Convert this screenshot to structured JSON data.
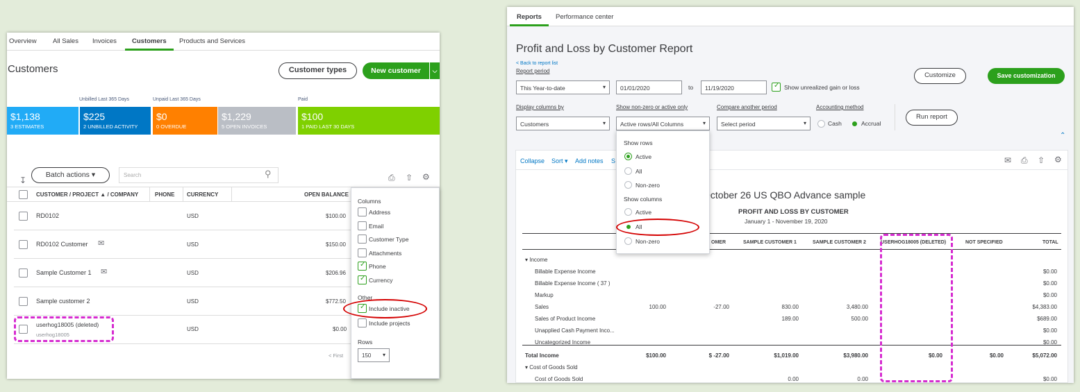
{
  "left": {
    "tabs": [
      "Overview",
      "All Sales",
      "Invoices",
      "Customers",
      "Products and Services"
    ],
    "title": "Customers",
    "customer_types_button": "Customer types",
    "new_customer_button": "New customer",
    "labels": {
      "unbilled": "Unbilled Last 365 Days",
      "unpaid": "Unpaid Last 365 Days",
      "paid": "Paid"
    },
    "tiles": [
      {
        "amount": "$1,138",
        "caption": "3 ESTIMATES",
        "color": "#21abf6"
      },
      {
        "amount": "$225",
        "caption": "2 UNBILLED ACTIVITY",
        "color": "#0077c5"
      },
      {
        "amount": "$0",
        "caption": "0 OVERDUE",
        "color": "#ff8000"
      },
      {
        "amount": "$1,229",
        "caption": "5 OPEN INVOICES",
        "color": "#babec5"
      },
      {
        "amount": "$100",
        "caption": "1 PAID LAST 30 DAYS",
        "color": "#7fd000"
      }
    ],
    "batch_actions": "Batch actions",
    "search_placeholder": "Search",
    "columns": [
      "CUSTOMER / PROJECT ▲ / COMPANY",
      "PHONE",
      "CURRENCY",
      "OPEN BALANCE"
    ],
    "rows": [
      {
        "name": "RD0102",
        "sub": "",
        "currency": "USD",
        "balance": "$100.00"
      },
      {
        "name": "RD0102 Customer",
        "sub": "",
        "currency": "USD",
        "balance": "$150.00"
      },
      {
        "name": "Sample Customer 1",
        "sub": "",
        "currency": "USD",
        "balance": "$206.96"
      },
      {
        "name": "Sample customer 2",
        "sub": "",
        "currency": "USD",
        "balance": "$772.50"
      },
      {
        "name": "userhog18005 (deleted)",
        "sub": "userhog18005",
        "currency": "USD",
        "balance": "$0.00"
      }
    ],
    "pager": "< First",
    "settings": {
      "columns_title": "Columns",
      "columns": [
        {
          "label": "Address",
          "checked": false
        },
        {
          "label": "Email",
          "checked": false
        },
        {
          "label": "Customer Type",
          "checked": false
        },
        {
          "label": "Attachments",
          "checked": false
        },
        {
          "label": "Phone",
          "checked": true
        },
        {
          "label": "Currency",
          "checked": true
        }
      ],
      "other_title": "Other",
      "other": [
        {
          "label": "Include inactive",
          "checked": true
        },
        {
          "label": "Include projects",
          "checked": false
        }
      ],
      "rows_title": "Rows",
      "rows_value": "150"
    }
  },
  "right": {
    "tabs": [
      "Reports",
      "Performance center"
    ],
    "title": "Profit and Loss by Customer Report",
    "back_link": "< Back to report list",
    "report_period_label": "Report period",
    "period_value": "This Year-to-date",
    "date_from": "01/01/2020",
    "to_label": "to",
    "date_to": "11/19/2020",
    "unrealized_label": "Show unrealized gain or loss",
    "customize_button": "Customize",
    "save_button": "Save customization",
    "display_columns_label": "Display columns by",
    "display_columns_value": "Customers",
    "nonzero_label": "Show non-zero or active only",
    "nonzero_value": "Active rows/All Columns",
    "compare_label": "Compare another period",
    "compare_value": "Select period",
    "accounting_label": "Accounting method",
    "cash_label": "Cash",
    "accrual_label": "Accrual",
    "run_report_button": "Run report",
    "dropdown": {
      "rows_title": "Show rows",
      "rows": [
        {
          "label": "Active",
          "on": true
        },
        {
          "label": "All",
          "on": false
        },
        {
          "label": "Non-zero",
          "on": false
        }
      ],
      "cols_title": "Show columns",
      "cols": [
        {
          "label": "Active",
          "on": false
        },
        {
          "label": "All",
          "on": true
        },
        {
          "label": "Non-zero",
          "on": false
        }
      ]
    },
    "toolbar": {
      "collapse": "Collapse",
      "sort": "Sort ▾",
      "add_notes": "Add notes",
      "extra": "S"
    },
    "company": "October 26 US QBO Advance sample",
    "report_heading": "PROFIT AND LOSS BY CUSTOMER",
    "report_dates": "January 1 - November 19, 2020",
    "col_headers": [
      "OMER",
      "SAMPLE CUSTOMER 1",
      "SAMPLE CUSTOMER 2",
      "USERHOG18005 (DELETED)",
      "NOT SPECIFIED",
      "TOTAL"
    ],
    "lines": [
      {
        "label": "▾ Income",
        "indent": 0,
        "bold": false,
        "vals": [
          "",
          "",
          "",
          "",
          "",
          "",
          "",
          ""
        ]
      },
      {
        "label": "Billable Expense Income",
        "indent": 1,
        "bold": false,
        "vals": [
          "",
          "",
          "",
          "",
          "",
          "",
          "",
          "$0.00"
        ]
      },
      {
        "label": "Billable Expense Income ( 37 )",
        "indent": 1,
        "bold": false,
        "vals": [
          "",
          "",
          "",
          "",
          "",
          "",
          "",
          "$0.00"
        ]
      },
      {
        "label": "Markup",
        "indent": 1,
        "bold": false,
        "vals": [
          "",
          "",
          "",
          "",
          "",
          "",
          "",
          "$0.00"
        ]
      },
      {
        "label": "Sales",
        "indent": 1,
        "bold": false,
        "vals": [
          "100.00",
          "-27.00",
          "830.00",
          "3,480.00",
          "",
          "",
          "",
          "$4,383.00"
        ]
      },
      {
        "label": "Sales of Product Income",
        "indent": 1,
        "bold": false,
        "vals": [
          "",
          "",
          "189.00",
          "500.00",
          "",
          "",
          "",
          "$689.00"
        ]
      },
      {
        "label": "Unapplied Cash Payment Inco...",
        "indent": 1,
        "bold": false,
        "vals": [
          "",
          "",
          "",
          "",
          "",
          "",
          "",
          "$0.00"
        ]
      },
      {
        "label": "Uncategorized Income",
        "indent": 1,
        "bold": false,
        "vals": [
          "",
          "",
          "",
          "",
          "",
          "",
          "",
          "$0.00"
        ]
      },
      {
        "label": "Total Income",
        "indent": 0,
        "bold": true,
        "vals": [
          "$100.00",
          "$ -27.00",
          "$1,019.00",
          "$3,980.00",
          "$0.00",
          "$0.00",
          "",
          "$5,072.00"
        ]
      },
      {
        "label": "▾ Cost of Goods Sold",
        "indent": 0,
        "bold": false,
        "vals": [
          "",
          "",
          "",
          "",
          "",
          "",
          "",
          ""
        ]
      },
      {
        "label": "Cost of Goods Sold",
        "indent": 1,
        "bold": false,
        "vals": [
          "",
          "",
          "0.00",
          "0.00",
          "",
          "",
          "",
          "$0.00"
        ]
      }
    ]
  }
}
